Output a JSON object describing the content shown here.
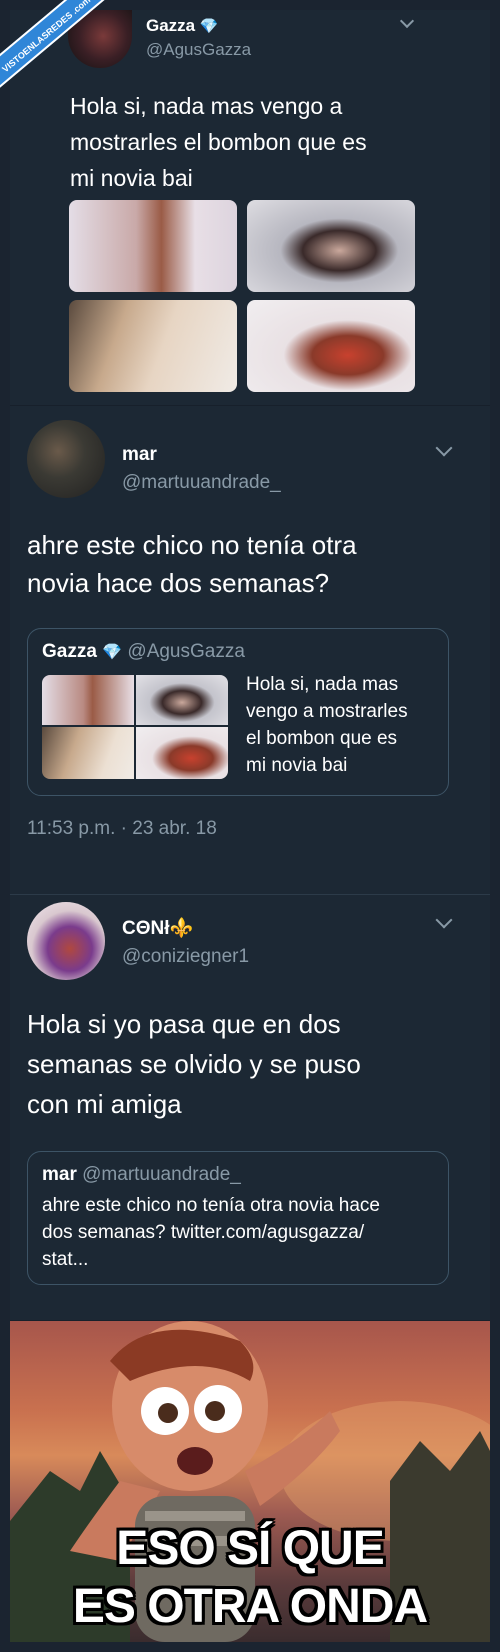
{
  "watermark": {
    "text": "VISTOENLASREDES .com"
  },
  "tweet1": {
    "name": "Gazza",
    "verified_emoji": "💎",
    "handle": "@AgusGazza",
    "text": "Hola si, nada mas vengo a\nmostrarles el bombon que es\nmi novia bai"
  },
  "tweet2": {
    "name": "mar",
    "handle": "@martuuandrade_",
    "text": "ahre este chico no tenía otra\nnovia hace dos semanas?",
    "quote": {
      "name": "Gazza",
      "emoji": "💎",
      "handle": "@AgusGazza",
      "text": "Hola si, nada mas\nvengo a mostrarles\nel bombon que es\nmi novia bai"
    },
    "timestamp": "11:53 p.m. · 23 abr. 18"
  },
  "tweet3": {
    "name": "CΘNł⚜️",
    "handle": "@coniziegner1",
    "text": "Hola si yo pasa que en dos\nsemanas se olvido y se puso\ncon mi amiga",
    "quote": {
      "name": "mar",
      "handle": "@martuuandrade_",
      "text": "ahre este chico no tenía otra novia hace\ndos semanas? twitter.com/agusgazza/\nstat..."
    }
  },
  "meme": {
    "line1": "ESO SÍ QUE",
    "line2": "ES OTRA ONDA"
  },
  "colors": {
    "background": "#1c2834",
    "muted": "#8899a6",
    "border": "#3d5466"
  }
}
